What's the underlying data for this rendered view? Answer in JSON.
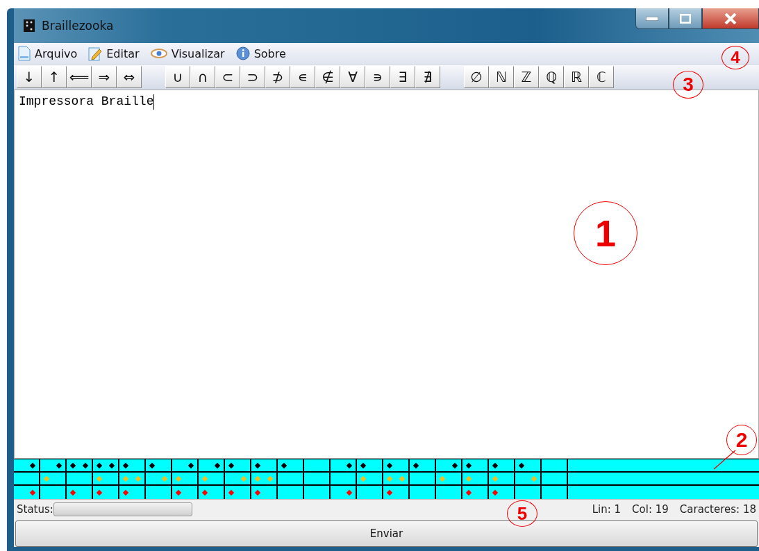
{
  "window": {
    "title": "Braillezooka"
  },
  "menu": [
    {
      "label": "Arquivo",
      "kind": "file"
    },
    {
      "label": "Editar",
      "kind": "edit"
    },
    {
      "label": "Visualizar",
      "kind": "view"
    },
    {
      "label": "Sobre",
      "kind": "info"
    }
  ],
  "toolbar_groups": [
    [
      "↓",
      "↑",
      "⟸",
      "⇒",
      "⇔"
    ],
    [
      "∪",
      "∩",
      "⊂",
      "⊃",
      "⊅",
      "∊",
      "∉",
      "∀",
      "∍",
      "∃",
      "∄"
    ],
    [
      "∅",
      "ℕ",
      "ℤ",
      "ℚ",
      "ℝ",
      "ℂ"
    ]
  ],
  "editor": {
    "value": "Impressora Braille"
  },
  "braille": {
    "cells": [
      {
        "dots": [
          false,
          false,
          false,
          true,
          false,
          true
        ]
      },
      {
        "dots": [
          false,
          true,
          false,
          true,
          false,
          false
        ]
      },
      {
        "dots": [
          true,
          false,
          true,
          true,
          false,
          false
        ]
      },
      {
        "dots": [
          true,
          true,
          true,
          true,
          false,
          false
        ]
      },
      {
        "dots": [
          true,
          true,
          true,
          false,
          true,
          false
        ]
      },
      {
        "dots": [
          true,
          false,
          false,
          false,
          true,
          false
        ]
      },
      {
        "dots": [
          false,
          true,
          true,
          true,
          false,
          false
        ]
      },
      {
        "dots": [
          false,
          true,
          true,
          true,
          false,
          false
        ]
      },
      {
        "dots": [
          true,
          false,
          true,
          false,
          true,
          false
        ]
      },
      {
        "dots": [
          true,
          true,
          true,
          false,
          true,
          false
        ]
      },
      {
        "dots": [
          true,
          false,
          false,
          false,
          false,
          false
        ]
      },
      {
        "dots": [
          false,
          false,
          false,
          false,
          false,
          false
        ]
      },
      {
        "dots": [
          false,
          false,
          false,
          true,
          false,
          true
        ]
      },
      {
        "dots": [
          true,
          true,
          false,
          false,
          false,
          false
        ]
      },
      {
        "dots": [
          true,
          true,
          true,
          false,
          true,
          false
        ]
      },
      {
        "dots": [
          true,
          false,
          false,
          false,
          false,
          false
        ]
      },
      {
        "dots": [
          false,
          true,
          false,
          true,
          false,
          false
        ]
      },
      {
        "dots": [
          true,
          true,
          true,
          false,
          false,
          false
        ]
      },
      {
        "dots": [
          true,
          true,
          true,
          false,
          false,
          false
        ]
      },
      {
        "dots": [
          true,
          false,
          false,
          false,
          true,
          false
        ]
      },
      {
        "dots": [
          false,
          false,
          false,
          false,
          false,
          false
        ]
      }
    ]
  },
  "status": {
    "label": "Status:",
    "level": 0,
    "line": "Lin: 1",
    "column": "Col: 19",
    "characters": "Caracteres: 18"
  },
  "send_button": "Enviar",
  "annotations": [
    "1",
    "2",
    "3",
    "4",
    "5"
  ]
}
